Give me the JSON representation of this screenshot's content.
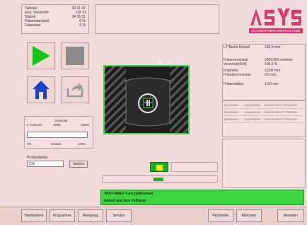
{
  "stats": [
    {
      "label": "Taktzeit",
      "value": "30 01 42"
    },
    {
      "label": "Ges. Stückzahl",
      "value": "118 St"
    },
    {
      "label": "Stdzeit",
      "value": "34 36 31"
    },
    {
      "label": "Fräserstandzeit",
      "value": "0 %"
    },
    {
      "label": "Fräserlast",
      "value": "0 %"
    }
  ],
  "logo": {
    "text": "ASYS",
    "tagline": "AUTOMATISIERUNGSSYSTEME",
    "color": "#d63a6e"
  },
  "controls": {
    "play": "play-icon",
    "stop": "stop-icon",
    "home": "home-icon",
    "exit": "exit-icon"
  },
  "feed": {
    "ruler_label": "Drehzahl",
    "ruler_start": "0 Vorlaeufe",
    "ruler_mid": "5000",
    "ruler_end": "10000",
    "bar_left": "0%",
    "bar_mid": "Gerade",
    "bar_right": "100%",
    "progress": 0.0
  },
  "product": {
    "label": "Produktfehler",
    "value": "516",
    "set_button": "Setzen"
  },
  "params": [
    {
      "label": "LP Breite Einlauf",
      "value": "140,0 mm"
    },
    {
      "label": "Fräservorschub",
      "value": "2000,000 mm/min"
    },
    {
      "label": "Vorschub(Soll)",
      "value": "100,0 %"
    },
    {
      "label": "Fräshöhe",
      "value": "3,000 mm"
    },
    {
      "label": "Fräsdurchmesser",
      "value": "0,0 mm"
    },
    {
      "label": "Fräserradius",
      "value": "1,00 mm"
    }
  ],
  "grid_rows": [
    [
      "Bearbeiten",
      "Angewählen",
      "Unterbrochen Fortsetzen"
    ],
    [
      "Bearbeiten",
      "Angewählen",
      "Unterbrochen Fortsetzen"
    ],
    [
      "Bearbeiten",
      "Angewählen",
      "Unterbrochen Fortsetzen"
    ]
  ],
  "status": {
    "line1": "TRAY-MNET 3 pcl (Editierbar)",
    "line2": "Ablauf aus dem Vollband",
    "color": "#3ed63e"
  },
  "toolbar_left": [
    "Handbetrieb",
    "Programme",
    "Werkzeug",
    "Service"
  ],
  "toolbar_right": [
    "Parameter",
    "Ethicalen",
    "Beenden"
  ]
}
